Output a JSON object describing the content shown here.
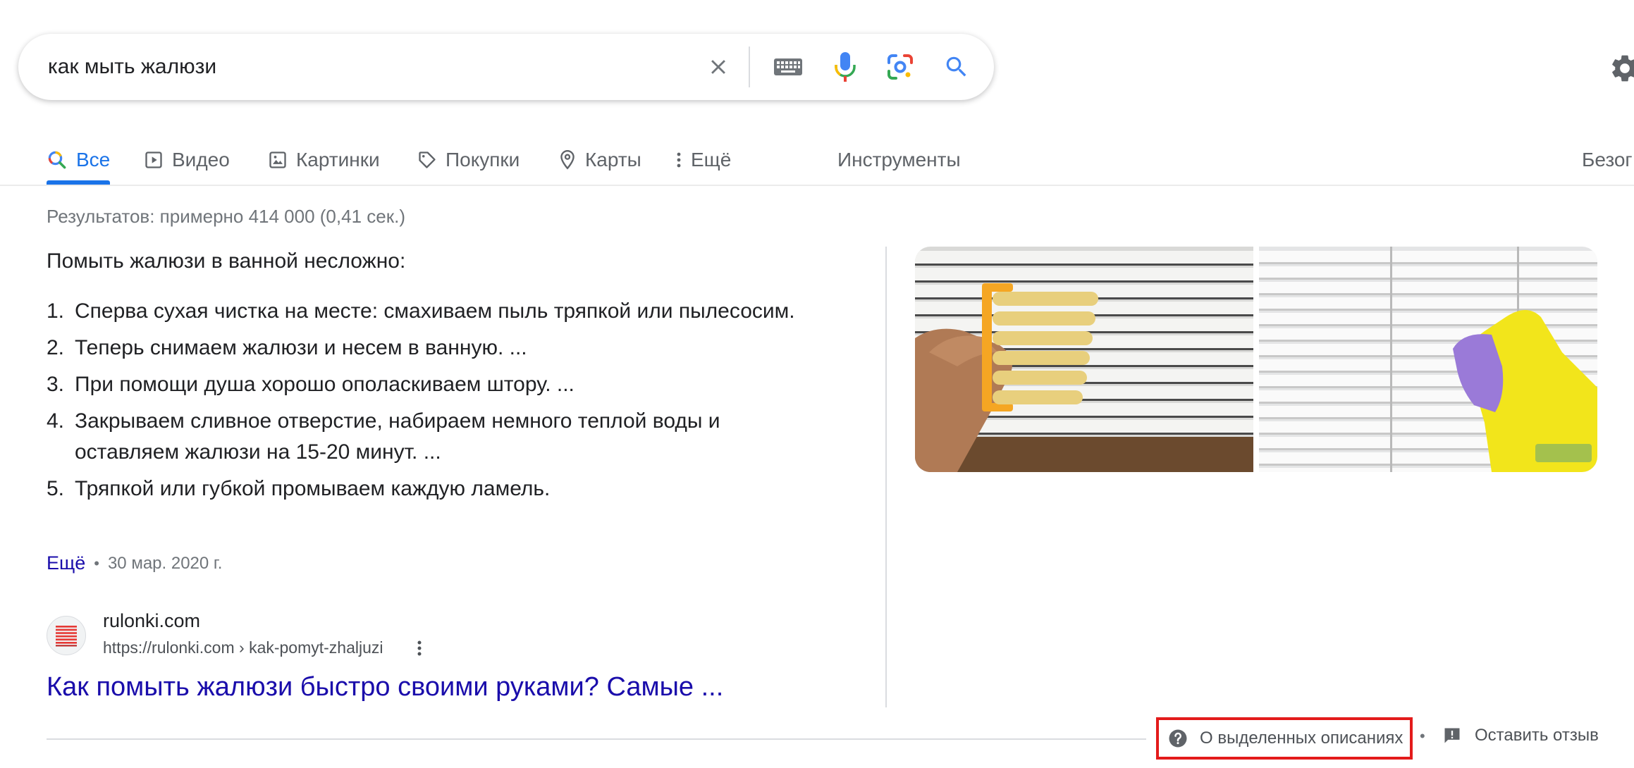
{
  "search": {
    "query": "как мыть жалюзи"
  },
  "tabs": [
    {
      "label": "Все",
      "active": true
    },
    {
      "label": "Видео",
      "active": false
    },
    {
      "label": "Картинки",
      "active": false
    },
    {
      "label": "Покупки",
      "active": false
    },
    {
      "label": "Карты",
      "active": false
    },
    {
      "label": "Ещё",
      "active": false
    }
  ],
  "tools_label": "Инструменты",
  "safesearch_label": "Безог",
  "result_stats": "Результатов: примерно 414 000 (0,41 сек.)",
  "snippet": {
    "heading": "Помыть жалюзи в ванной несложно:",
    "steps": [
      {
        "num": "1.",
        "text": "Сперва сухая чистка на месте: смахиваем пыль тряпкой или пылесосим."
      },
      {
        "num": "2.",
        "text": "Теперь снимаем жалюзи и несем в ванную. ..."
      },
      {
        "num": "3.",
        "text": "При помощи душа хорошо ополаскиваем штору. ..."
      },
      {
        "num": "4.",
        "text": "Закрываем сливное отверстие, набираем немного теплой воды и оставляем жалюзи на 15-20 минут. ..."
      },
      {
        "num": "5.",
        "text": "Тряпкой или губкой промываем каждую ламель."
      }
    ],
    "more_label": "Ещё",
    "date": "30 мар. 2020 г."
  },
  "source": {
    "site_name": "rulonki.com",
    "url": "https://rulonki.com › kak-pomyt-zhaljuzi",
    "title": "Как помыть жалюзи быстро своими руками? Самые ..."
  },
  "footer": {
    "about_label": "О выделенных описаниях",
    "feedback_label": "Оставить отзыв"
  },
  "colors": {
    "accent": "#1a73e8",
    "link": "#1a0dab",
    "highlight_border": "#e31b1b"
  }
}
